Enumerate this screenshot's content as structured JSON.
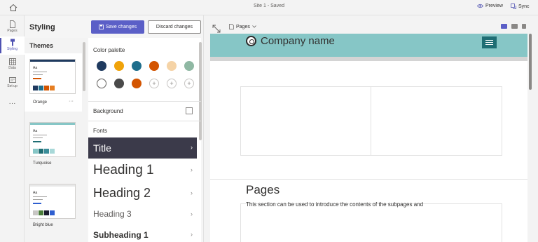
{
  "topbar": {
    "title": "Site 1 - Saved",
    "preview_label": "Preview",
    "sync_label": "Sync"
  },
  "rail": {
    "items": [
      {
        "label": "Pages",
        "icon": "page-icon"
      },
      {
        "label": "Styling",
        "icon": "brush-icon"
      },
      {
        "label": "Data",
        "icon": "table-icon"
      },
      {
        "label": "Set up",
        "icon": "setup-icon"
      }
    ],
    "more": "···"
  },
  "styling": {
    "title": "Styling",
    "themes_title": "Themes",
    "themes": [
      {
        "name": "Orange",
        "bar": "#1f3a5f",
        "swatches": [
          "#1f3a5f",
          "#1f6e8c",
          "#d35400",
          "#e67e22"
        ],
        "accent": "#d35400"
      },
      {
        "name": "Turquoise",
        "bar": "#86c6c6",
        "swatches": [
          "#86c6c6",
          "#1f6e74",
          "#3b8d99",
          "#a8d8d8"
        ],
        "accent": "#1f6e74"
      },
      {
        "name": "Bright blue",
        "bar": "#e8e8e8",
        "swatches": [
          "#c8c6c4",
          "#4a7c3a",
          "#1b1b2f",
          "#2f5fd0"
        ],
        "accent": "#2f5fd0"
      }
    ],
    "more_glyph": "···"
  },
  "buttons": {
    "save": "Save changes",
    "discard": "Discard changes"
  },
  "palette": {
    "title": "Color palette",
    "row1": [
      "#1f3a5f",
      "#f0a30a",
      "#1f6e8c",
      "#d35400",
      "#f5d3a6",
      "#8fb8a3"
    ],
    "row2": [
      "#ffffff",
      "#4a4a4a",
      "#d35400"
    ],
    "add_glyph": "+"
  },
  "background": {
    "label": "Background"
  },
  "fonts": {
    "label": "Fonts",
    "items": [
      {
        "label": "Title"
      },
      {
        "label": "Heading 1"
      },
      {
        "label": "Heading 2"
      },
      {
        "label": "Heading 3"
      },
      {
        "label": "Subheading 1"
      }
    ],
    "chevron": "›"
  },
  "canvas": {
    "pages_dropdown": "Pages",
    "company_name": "Company name",
    "section_title": "Pages",
    "section_desc": "This section can be used to introduce the contents of the subpages and"
  }
}
